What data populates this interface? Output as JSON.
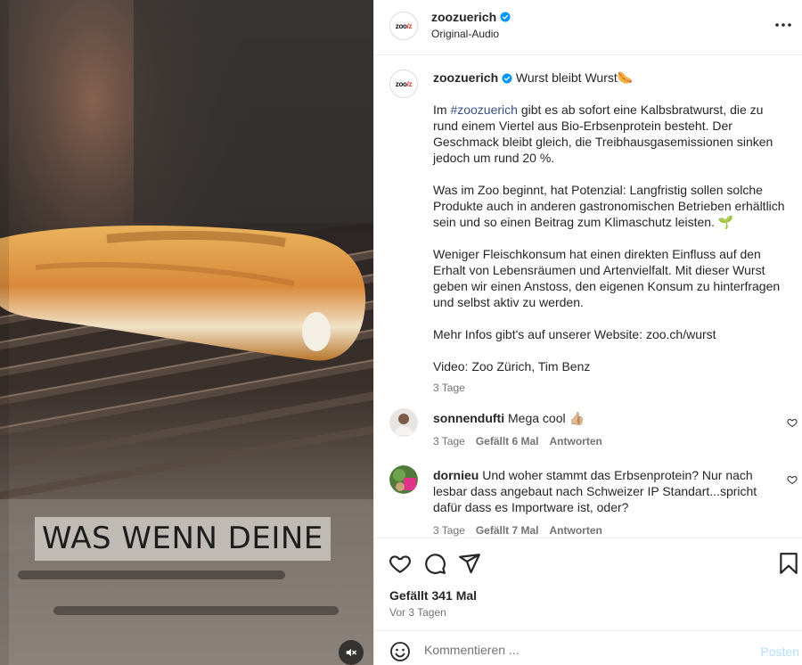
{
  "media": {
    "caption_overlay": "WAS WENN DEINE",
    "mute_icon": "speaker-muted-icon"
  },
  "header": {
    "username": "zoozuerich",
    "audio": "Original-Audio",
    "avatar_text_main": "zoo",
    "avatar_text_accent": "/z",
    "more_icon": "more-horizontal-icon"
  },
  "post_caption": {
    "username": "zoozuerich",
    "title": "Wurst bleibt Wurst🌭",
    "para1_pre": "Im ",
    "hashtag": "#zoozuerich",
    "para1_post": " gibt es ab sofort eine Kalbsbratwurst, die zu rund einem Viertel aus Bio-Erbsenprotein besteht. Der Geschmack bleibt gleich, die Treibhausgasemissionen sinken jedoch um rund 20 %.",
    "para2": "Was im Zoo beginnt, hat Potenzial: Langfristig sollen solche Produkte auch in anderen gastronomischen Betrieben erhältlich sein und so einen Beitrag zum Klimaschutz leisten. 🌱",
    "para3": "Weniger Fleischkonsum hat einen direkten Einfluss auf den Erhalt von Lebensräumen und Artenvielfalt. Mit dieser Wurst geben wir einen Anstoss, den eigenen Konsum zu hinterfragen und selbst aktiv zu werden.",
    "para4": "Mehr Infos gibt's auf unserer Website: zoo.ch/wurst",
    "para5": "Video: Zoo Zürich, Tim Benz",
    "time": "3 Tage"
  },
  "comments": [
    {
      "username": "sonnendufti",
      "text": "Mega cool 👍🏼",
      "time": "3 Tage",
      "likes": "Gefällt 6 Mal",
      "reply": "Antworten"
    },
    {
      "username": "dornieu",
      "text": "Und woher stammt das Erbsenprotein? Nur nach lesbar dass angebaut nach Schweizer IP Standart...spricht dafür dass es Importware ist, oder?",
      "time": "3 Tage",
      "likes": "Gefällt 7 Mal",
      "reply": "Antworten"
    }
  ],
  "actions": {
    "likes": "Gefällt 341 Mal",
    "date": "Vor 3 Tagen",
    "icons": [
      "heart-icon",
      "comment-icon",
      "share-icon",
      "bookmark-icon"
    ]
  },
  "comment_bar": {
    "placeholder": "Kommentieren ...",
    "post_label": "Posten",
    "emoji_icon": "emoji-icon"
  },
  "colors": {
    "hashtag": "#385185",
    "verified": "#0095f6",
    "post_button_disabled": "#b2dffc",
    "secondary_text": "#737373"
  }
}
